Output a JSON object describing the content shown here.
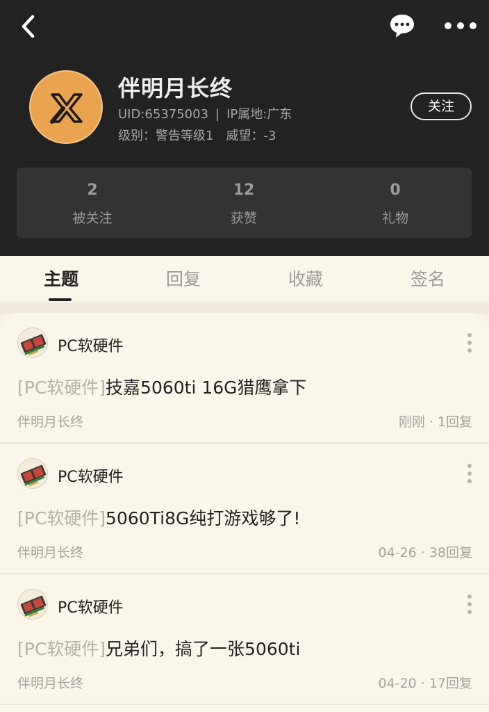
{
  "profile": {
    "username": "伴明月长终",
    "uid": "UID:65375003",
    "ip": "IP属地:广东",
    "level": "级别：警告等级1",
    "prestige": "威望：-3",
    "follow_label": "关注"
  },
  "stats": [
    {
      "value": "2",
      "label": "被关注"
    },
    {
      "value": "12",
      "label": "获赞"
    },
    {
      "value": "0",
      "label": "礼物"
    }
  ],
  "tabs": [
    "主题",
    "回复",
    "收藏",
    "签名"
  ],
  "active_tab": "主题",
  "posts": [
    {
      "forum": "PC软硬件",
      "tag": "[PC软硬件]",
      "title": "技嘉5060ti 16G猎鹰拿下",
      "author": "伴明月长终",
      "time": "刚刚",
      "replies": "1回复"
    },
    {
      "forum": "PC软硬件",
      "tag": "[PC软硬件]",
      "title": "5060Ti8G纯打游戏够了!",
      "author": "伴明月长终",
      "time": "04-26",
      "replies": "38回复"
    },
    {
      "forum": "PC软硬件",
      "tag": "[PC软硬件]",
      "title": "兄弟们，搞了一张5060ti",
      "author": "伴明月长终",
      "time": "04-20",
      "replies": "17回复"
    }
  ],
  "colors": {
    "header_bg": "#222222",
    "avatar_bg": "#eaa34f",
    "page_bg": "#faf6ea",
    "tag_text": "#b8b2a6"
  },
  "icons": {
    "back": "chevron-left-icon",
    "message": "chat-bubble-icon",
    "more": "more-dots-icon",
    "avatar": "x-logo-avatar",
    "forum": "graphics-card-icon",
    "post_more": "vertical-dots-icon"
  }
}
